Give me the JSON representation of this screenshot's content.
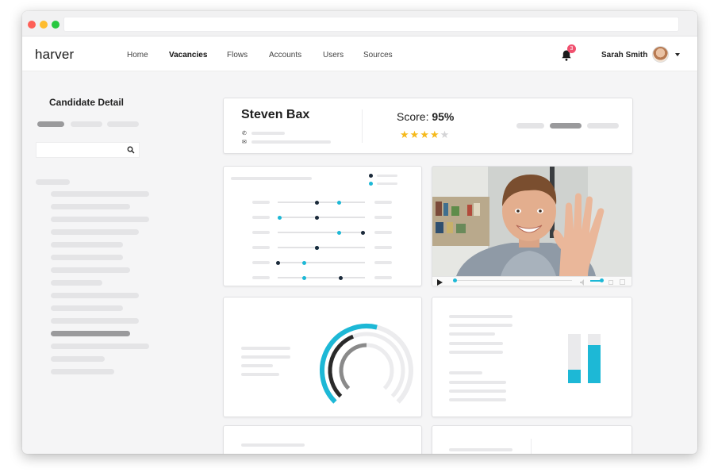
{
  "nav": {
    "logo": "harver",
    "items": [
      {
        "label": "Home",
        "active": false
      },
      {
        "label": "Vacancies",
        "active": true
      },
      {
        "label": "Flows",
        "active": false
      },
      {
        "label": "Accounts",
        "active": false
      },
      {
        "label": "Users",
        "active": false
      },
      {
        "label": "Sources",
        "active": false
      }
    ],
    "notification_count": "3",
    "user_name": "Sarah Smith"
  },
  "sidebar": {
    "title": "Candidate Detail"
  },
  "candidate": {
    "name": "Steven Bax",
    "score_label": "Score:",
    "score_value": "95%",
    "rating": 4,
    "rating_max": 5
  },
  "icons": {
    "phone": "phone-icon",
    "email": "envelope-icon",
    "bell": "bell-icon",
    "search": "search-icon",
    "play": "play-icon",
    "volume": "volume-icon",
    "fullscreen": "fullscreen-icon"
  },
  "colors": {
    "accent": "#1db8d6",
    "dark": "#1b2a3a",
    "star": "#f5b91c",
    "badge": "#f0506e"
  },
  "sliders": [
    {
      "teal": 0.7,
      "navy": 0.45
    },
    {
      "teal": 0.02,
      "navy": 0.45
    },
    {
      "teal": 0.7,
      "navy": 0.98
    },
    {
      "teal": 0.45,
      "navy": 0.45
    },
    {
      "teal": 0.3,
      "navy": 0.0
    },
    {
      "teal": 0.3,
      "navy": 0.72
    }
  ],
  "radial_chart": {
    "rings": [
      {
        "color": "#1db8d6",
        "fraction": 0.55
      },
      {
        "color": "#2a2a2a",
        "fraction": 0.42
      },
      {
        "color": "#8a8a8a",
        "fraction": 0.5
      }
    ]
  },
  "bar_chart": {
    "bars": [
      {
        "teal": 0.28
      },
      {
        "teal": 0.78
      }
    ]
  }
}
